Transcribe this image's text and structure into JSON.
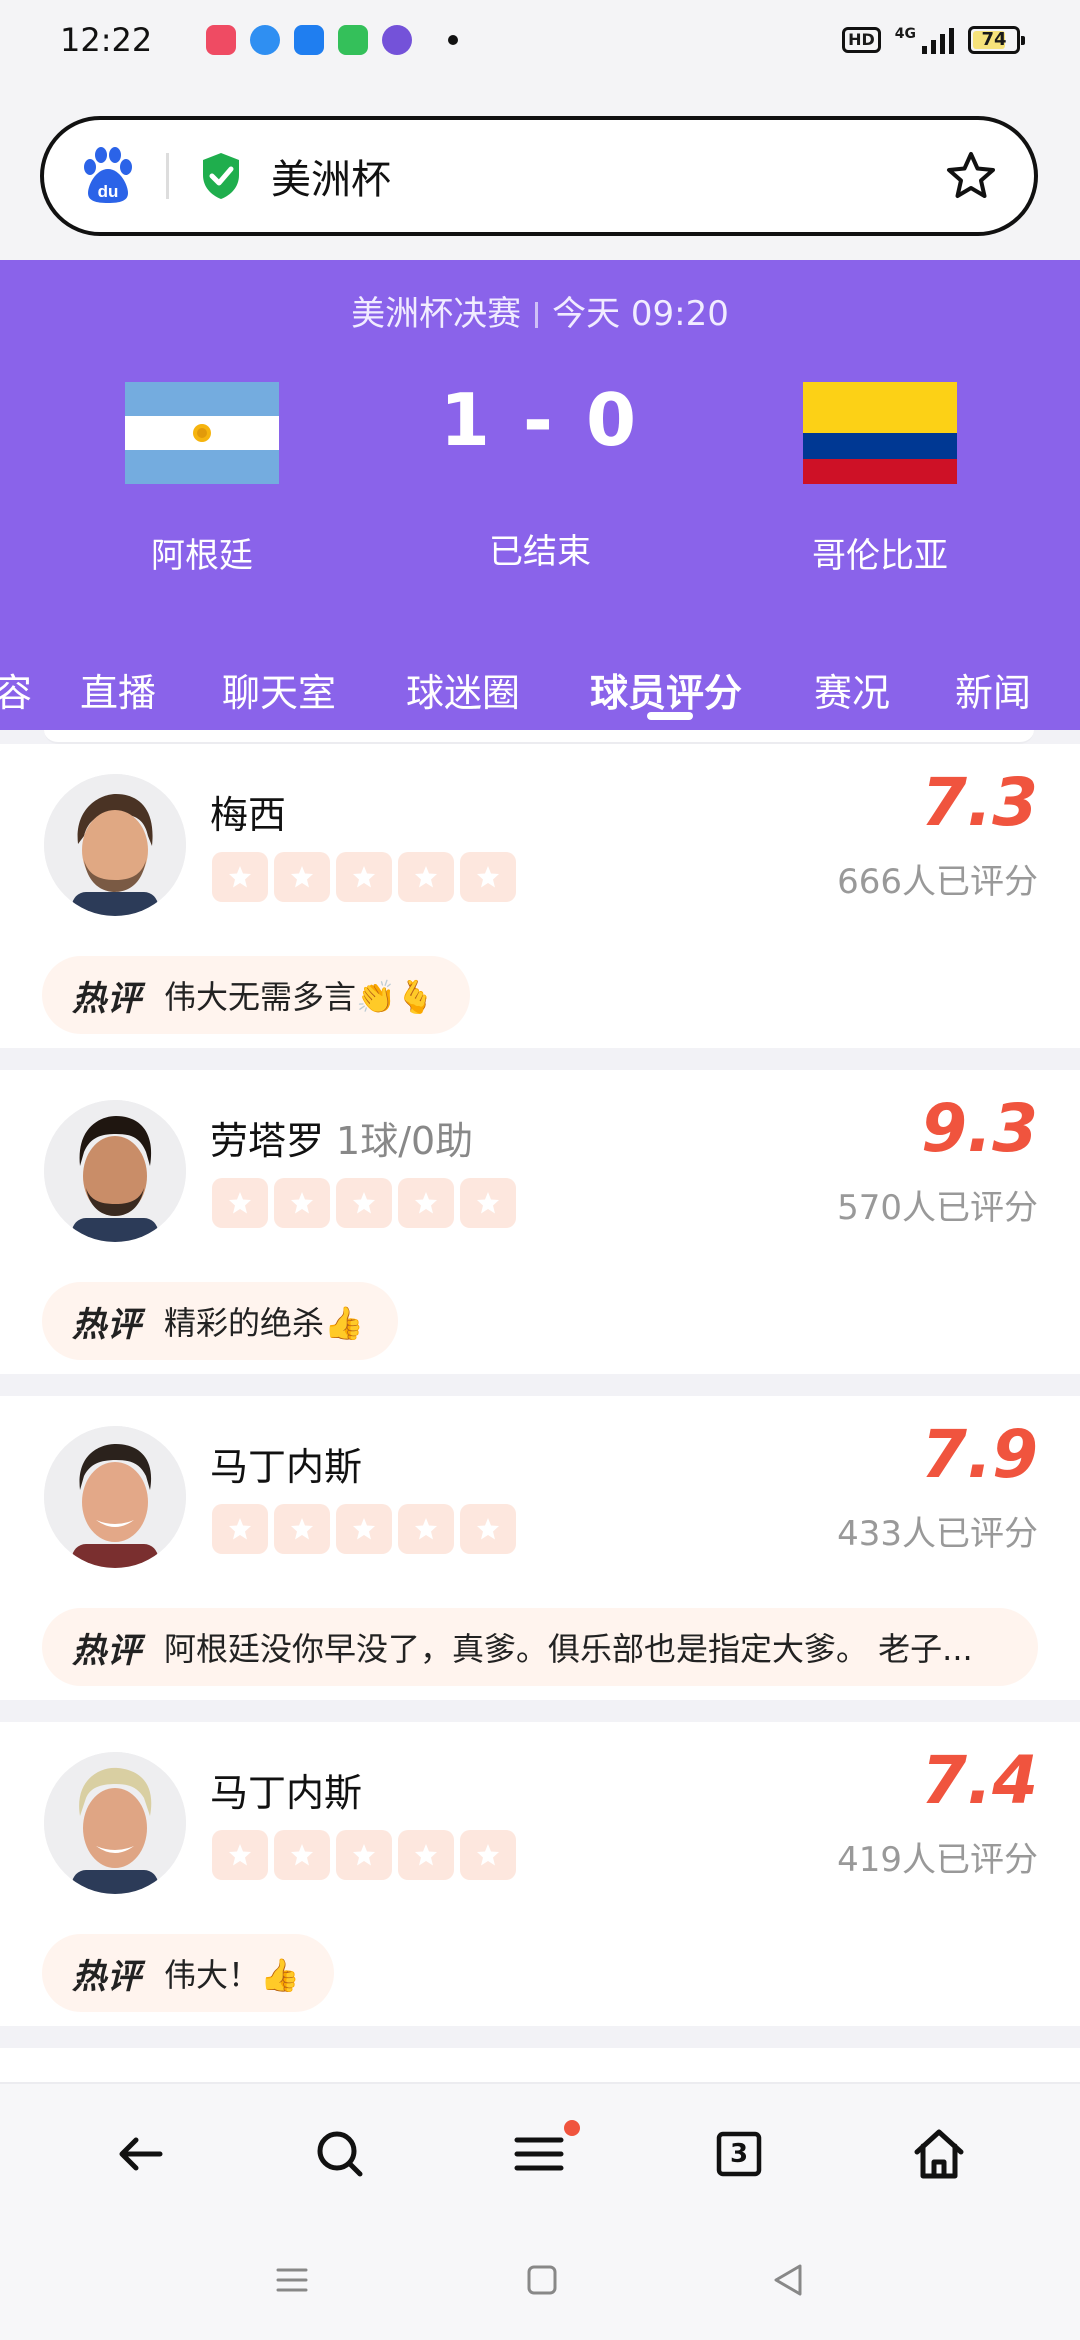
{
  "status_bar": {
    "time": "12:22",
    "hd": "HD",
    "network": "4G",
    "battery": "74",
    "app_icons": [
      {
        "name": "app-red-icon",
        "color": "#ef4b63"
      },
      {
        "name": "app-blue-icon",
        "color": "#2f8ff2"
      },
      {
        "name": "alipay-icon",
        "color": "#1f7ef0"
      },
      {
        "name": "app-green-icon",
        "color": "#34c05a"
      },
      {
        "name": "app-purple-icon",
        "color": "#7452d9"
      }
    ]
  },
  "search": {
    "query": "美洲杯"
  },
  "match": {
    "title": "美洲杯决赛",
    "time": "今天 09:20",
    "score": "1 - 0",
    "status": "已结束",
    "home_team": "阿根廷",
    "away_team": "哥伦比亚",
    "colors": {
      "header_bg": "#8a63ea",
      "accent": "#f0543e"
    }
  },
  "tabs": [
    {
      "label": "容"
    },
    {
      "label": "直播"
    },
    {
      "label": "聊天室"
    },
    {
      "label": "球迷圈"
    },
    {
      "label": "球员评分",
      "active": true
    },
    {
      "label": "赛况"
    },
    {
      "label": "新闻"
    }
  ],
  "players": [
    {
      "name": "梅西",
      "stats": "",
      "rating": "7.3",
      "raters": "666人已评分",
      "hot_label": "热评",
      "comment": "伟大无需多言👏🫰"
    },
    {
      "name": "劳塔罗",
      "stats": "1球/0助",
      "rating": "9.3",
      "raters": "570人已评分",
      "hot_label": "热评",
      "comment": "精彩的绝杀👍"
    },
    {
      "name": "马丁内斯",
      "stats": "",
      "rating": "7.9",
      "raters": "433人已评分",
      "hot_label": "热评",
      "comment": "阿根廷没你早没了，真爹。俱乐部也是指定大爹。 老子..."
    },
    {
      "name": "马丁内斯",
      "stats": "",
      "rating": "7.4",
      "raters": "419人已评分",
      "hot_label": "热评",
      "comment": "伟大！👍"
    }
  ],
  "bottom_nav": {
    "tab_count": "3",
    "icons": [
      "back-icon",
      "search-icon",
      "menu-icon",
      "tabs-icon",
      "home-icon"
    ]
  }
}
